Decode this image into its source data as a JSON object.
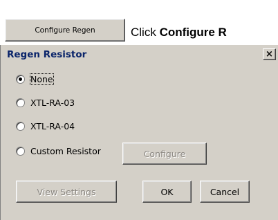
{
  "top": {
    "button_label": "Configure Regen",
    "instruction_prefix": "Click ",
    "instruction_bold": "Configure R"
  },
  "dialog": {
    "title": "Regen Resistor",
    "close_glyph": "×",
    "options": [
      {
        "label": "None",
        "checked": true
      },
      {
        "label": "XTL-RA-03",
        "checked": false
      },
      {
        "label": "XTL-RA-04",
        "checked": false
      },
      {
        "label": "Custom Resistor",
        "checked": false
      }
    ],
    "configure_label": "Configure",
    "view_settings_label": "View Settings",
    "ok_label": "OK",
    "cancel_label": "Cancel"
  }
}
